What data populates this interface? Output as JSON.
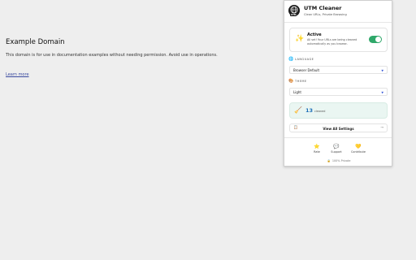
{
  "page": {
    "heading": "Example Domain",
    "body": "This domain is for use in documentation examples without needing permission. Avoid use in operations.",
    "link": "Learn more"
  },
  "popup": {
    "app_title": "UTM Cleaner",
    "app_subtitle": "Clean URLs, Private Browsing",
    "logo_label": "UTM",
    "active": {
      "title": "Active",
      "description": "All set! Your URLs are being cleaned automatically as you browse.",
      "enabled": true
    },
    "language": {
      "label": "LANGUAGE",
      "value": "Browser Default"
    },
    "theme": {
      "label": "THEME",
      "value": "Light"
    },
    "stats": {
      "count": "13",
      "unit": "cleaned"
    },
    "view_all": "View All Settings",
    "footer": [
      {
        "icon": "star-icon",
        "label": "Rate"
      },
      {
        "icon": "chat-icon",
        "label": "Support"
      },
      {
        "icon": "heart-icon",
        "label": "Contribute"
      }
    ],
    "privacy": "100% Private"
  },
  "colors": {
    "toggle_on": "#2fa86a",
    "stat_bg": "#eaf6f2",
    "stat_number": "#1d6fb8"
  }
}
